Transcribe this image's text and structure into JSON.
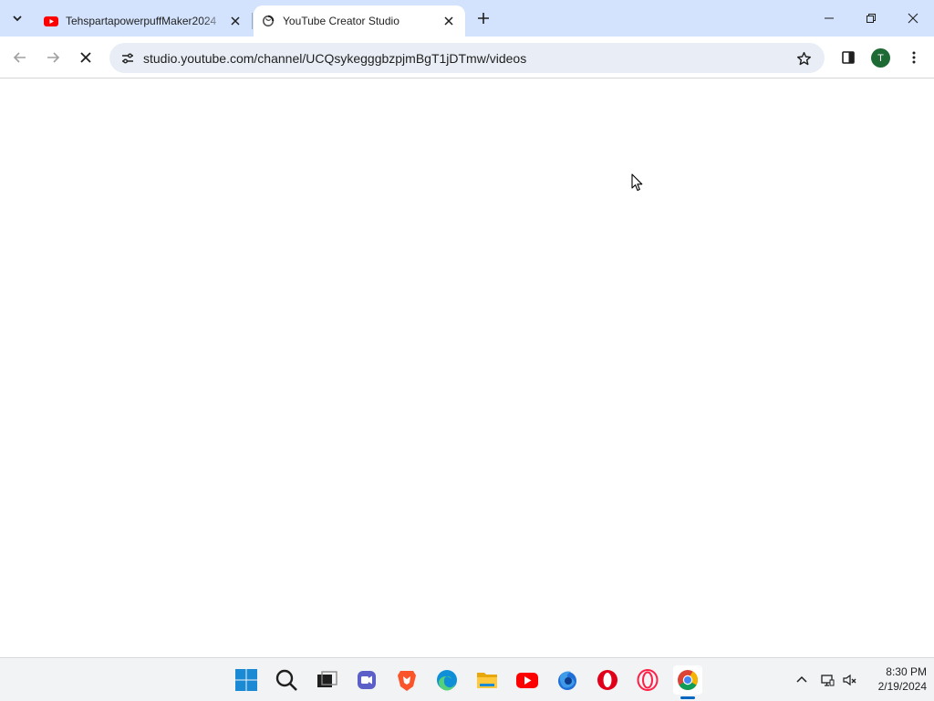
{
  "browser": {
    "tabs": [
      {
        "title": "TehspartapowerpuffMaker2024",
        "favicon": "youtube-icon",
        "active": false
      },
      {
        "title": "YouTube Creator Studio",
        "favicon": "loading-globe-icon",
        "active": true
      }
    ],
    "url": "studio.youtube.com/channel/UCQsykegggbzpjmBgT1jDTmw/videos",
    "profile_initial": "T",
    "loading": true
  },
  "taskbar": {
    "apps": [
      "windows-start-icon",
      "search-icon",
      "task-view-icon",
      "meet-icon",
      "brave-icon",
      "edge-icon",
      "file-explorer-icon",
      "youtube-icon",
      "firefox-icon",
      "opera-icon",
      "opera-gx-icon",
      "chrome-icon"
    ],
    "active_app": "chrome-icon",
    "time": "8:30 PM",
    "date": "2/19/2024"
  },
  "colors": {
    "tabstrip": "#d3e3fd",
    "omnibox": "#e9eef6",
    "avatar": "#1e6a34",
    "taskbar": "#f2f3f5",
    "youtube_red": "#ff0000"
  }
}
